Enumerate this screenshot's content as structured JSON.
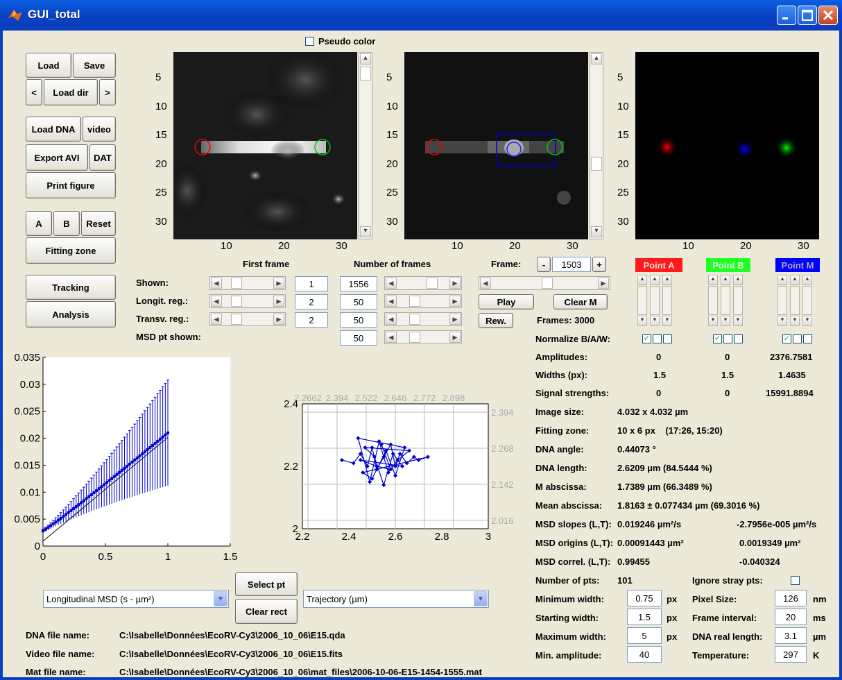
{
  "window": {
    "title": "GUI_total"
  },
  "top": {
    "pseudo_color_label": "Pseudo color",
    "pseudo_color_checked": false
  },
  "buttons": {
    "load": "Load",
    "save": "Save",
    "prev": "<",
    "load_dir": "Load dir",
    "next": ">",
    "load_dna": "Load DNA",
    "video": "video",
    "export_avi": "Export AVI",
    "dat": "DAT",
    "print_figure": "Print figure",
    "a": "A",
    "b": "B",
    "reset": "Reset",
    "fitting_zone": "Fitting zone",
    "tracking": "Tracking",
    "analysis": "Analysis",
    "play": "Play",
    "clear_m": "Clear M",
    "rew": "Rew.",
    "select_pt": "Select pt",
    "clear_rect": "Clear rect",
    "frame_minus": "-",
    "frame_plus": "+"
  },
  "images": {
    "y_ticks": [
      "5",
      "10",
      "15",
      "20",
      "25",
      "30"
    ],
    "x_ticks": [
      "10",
      "20",
      "30"
    ]
  },
  "frames": {
    "first_frame_label": "First frame",
    "number_of_frames_label": "Number of frames",
    "frame_label": "Frame:",
    "frame_value": "1503",
    "frames_total": "Frames: 3000",
    "rows": [
      {
        "label": "Shown:",
        "first": "1",
        "number": "1556"
      },
      {
        "label": "Longit. reg.:",
        "first": "2",
        "number": "50"
      },
      {
        "label": "Transv. reg.:",
        "first": "2",
        "number": "50"
      },
      {
        "label": "MSD pt shown:",
        "number": "50"
      }
    ]
  },
  "points": {
    "a": {
      "label": "Point A",
      "color": "#ff1a1a"
    },
    "b": {
      "label": "Point B",
      "color": "#1aff1a"
    },
    "m": {
      "label": "Point M",
      "color": "#0000ff"
    }
  },
  "stats": {
    "normalize_label": "Normalize B/A/W:",
    "amplitudes_label": "Amplitudes:",
    "amplitudes": [
      "0",
      "0",
      "2376.7581"
    ],
    "widths_label": "Widths (px):",
    "widths": [
      "1.5",
      "1.5",
      "1.4635"
    ],
    "signal_label": "Signal strengths:",
    "signal": [
      "0",
      "0",
      "15991.8894"
    ],
    "image_size_label": "Image size:",
    "image_size": "4.032 x 4.032 µm",
    "fitting_zone_label": "Fitting zone:",
    "fitting_zone": "10 x 6 px    (17:26, 15:20)",
    "dna_angle_label": "DNA angle:",
    "dna_angle": "0.44073 °",
    "dna_length_label": "DNA length:",
    "dna_length": "2.6209 µm (84.5444 %)",
    "m_abscissa_label": "M abscissa:",
    "m_abscissa": "1.7389 µm (66.3489 %)",
    "mean_abscissa_label": "Mean abscissa:",
    "mean_abscissa": "1.8163 ± 0.077434 µm (69.3016 %)",
    "msd_slopes_label": "MSD slopes (L,T):",
    "msd_slopes_l": "0.019246 µm²/s",
    "msd_slopes_t": "-2.7956e-005 µm²/s",
    "msd_origins_label": "MSD origins (L,T):",
    "msd_origins_l": "0.00091443 µm²",
    "msd_origins_t": "0.0019349 µm²",
    "msd_correl_label": "MSD correl. (L,T):",
    "msd_correl_l": "0.99455",
    "msd_correl_t": "-0.040324",
    "number_pts_label": "Number of pts:",
    "number_pts": "101",
    "ignore_stray_label": "Ignore stray pts:"
  },
  "params": {
    "min_width_label": "Minimum width:",
    "min_width": "0.75",
    "start_width_label": "Starting width:",
    "start_width": "1.5",
    "max_width_label": "Maximum width:",
    "max_width": "5",
    "min_amp_label": "Min. amplitude:",
    "min_amp": "40",
    "px_unit": "px",
    "pixel_size_label": "Pixel Size:",
    "pixel_size": "126",
    "pixel_size_unit": "nm",
    "frame_interval_label": "Frame interval:",
    "frame_interval": "20",
    "frame_interval_unit": "ms",
    "dna_real_label": "DNA real length:",
    "dna_real": "3.1",
    "dna_real_unit": "µm",
    "temperature_label": "Temperature:",
    "temperature": "297",
    "temperature_unit": "K"
  },
  "combos": {
    "left": "Longitudinal MSD (s - µm²)",
    "right": "Trajectory (µm)"
  },
  "files": {
    "dna_label": "DNA file name:",
    "dna": "C:\\Isabelle\\Données\\EcoRV-Cy3\\2006_10_06\\E15.qda",
    "video_label": "Video file name:",
    "video": "C:\\Isabelle\\Données\\EcoRV-Cy3\\2006_10_06\\E15.fits",
    "mat_label": "Mat file name:",
    "mat": "C:\\Isabelle\\Données\\EcoRV-Cy3\\2006_10_06\\mat_files\\2006-10-06-E15-1454-1555.mat"
  },
  "chart_data": [
    {
      "type": "line",
      "title": "",
      "xlabel": "",
      "ylabel": "",
      "xlim": [
        0,
        1.5
      ],
      "ylim": [
        0,
        0.035
      ],
      "x_ticks": [
        "0",
        "0.5",
        "1",
        "1.5"
      ],
      "y_ticks": [
        "0",
        "0.005",
        "0.01",
        "0.015",
        "0.02",
        "0.025",
        "0.03",
        "0.035"
      ],
      "fit_line": {
        "slope": 0.019246,
        "intercept": 0.00091443
      },
      "series": [
        {
          "x_start": 0,
          "x_end": 1.0,
          "n": 50,
          "y_start": 0.0028,
          "y_end": 0.021
        }
      ],
      "error_bars": true,
      "color": "#0000cc"
    },
    {
      "type": "scatter",
      "title": "",
      "xlim": [
        2.2,
        3.0
      ],
      "ylim": [
        2.0,
        2.4
      ],
      "x_ticks": [
        "2.2",
        "2.4",
        "2.6",
        "2.8",
        "3"
      ],
      "y_ticks": [
        "2",
        "2.2",
        "2.4"
      ],
      "top_ticks": [
        "2.2662",
        "2.394",
        "2.522",
        "2.646",
        "2.772",
        "2.898"
      ],
      "right_ticks": [
        "2.394",
        "2.268",
        "2.142",
        "2.016"
      ],
      "points_x": [
        2.37,
        2.42,
        2.45,
        2.48,
        2.5,
        2.52,
        2.55,
        2.58,
        2.6,
        2.62,
        2.65,
        2.68,
        2.7,
        2.74,
        2.46,
        2.5,
        2.56,
        2.6,
        2.64,
        2.44,
        2.49,
        2.53,
        2.57,
        2.61,
        2.66,
        2.47,
        2.51,
        2.55,
        2.59,
        2.63,
        2.45,
        2.52,
        2.58,
        2.54
      ],
      "points_y": [
        2.22,
        2.21,
        2.24,
        2.2,
        2.26,
        2.19,
        2.23,
        2.27,
        2.2,
        2.24,
        2.21,
        2.23,
        2.22,
        2.23,
        2.18,
        2.16,
        2.25,
        2.17,
        2.26,
        2.29,
        2.15,
        2.28,
        2.18,
        2.22,
        2.25,
        2.26,
        2.23,
        2.14,
        2.24,
        2.2,
        2.22,
        2.2,
        2.19,
        2.27
      ],
      "color": "#0000cc"
    }
  ]
}
